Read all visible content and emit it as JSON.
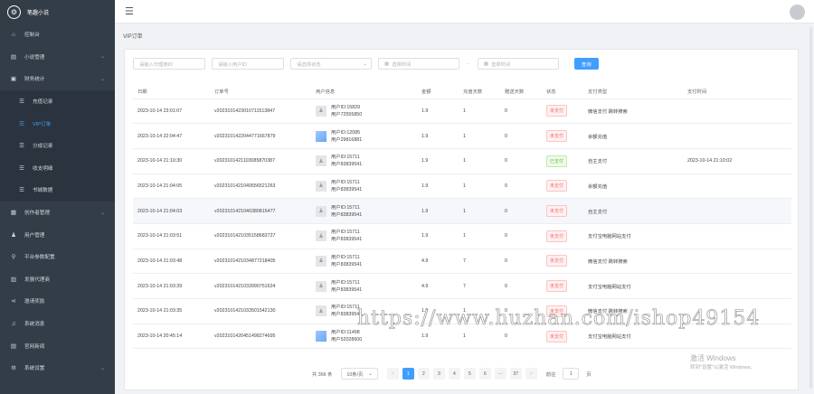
{
  "app": {
    "brand": "笔趣小说",
    "logo_icon": "settings-logo-icon"
  },
  "sidebar": {
    "items": [
      {
        "label": "控制台",
        "icon": "home-icon",
        "glyph": "⌂",
        "caret": false
      },
      {
        "label": "小说管理",
        "icon": "book-icon",
        "glyph": "▤",
        "caret": true
      },
      {
        "label": "财务统计",
        "icon": "money-icon",
        "glyph": "▣",
        "caret": true
      }
    ],
    "sub_items": [
      {
        "label": "充值记录",
        "glyph": "☰",
        "active": false
      },
      {
        "label": "VIP订单",
        "glyph": "☰",
        "active": true
      },
      {
        "label": "分成记录",
        "glyph": "☰",
        "active": false
      },
      {
        "label": "收支明细",
        "glyph": "☰",
        "active": false
      },
      {
        "label": "书城数据",
        "glyph": "☰",
        "active": false
      }
    ],
    "items_after": [
      {
        "label": "创作者管理",
        "icon": "users-icon",
        "glyph": "▦",
        "caret": true
      },
      {
        "label": "用户管理",
        "icon": "user-icon",
        "glyph": "♟",
        "caret": false
      },
      {
        "label": "平台参数配置",
        "icon": "pin-icon",
        "glyph": "⚲",
        "caret": false
      },
      {
        "label": "发展代理商",
        "icon": "grid-icon",
        "glyph": "▥",
        "caret": false
      },
      {
        "label": "邀请奖励",
        "icon": "share-icon",
        "glyph": "⋖",
        "caret": false
      },
      {
        "label": "系统消息",
        "icon": "bell-icon",
        "glyph": "♫",
        "caret": false
      },
      {
        "label": "官网新闻",
        "icon": "news-icon",
        "glyph": "▤",
        "caret": false
      },
      {
        "label": "系统设置",
        "icon": "gear-icon",
        "glyph": "⚙",
        "caret": true
      }
    ]
  },
  "topbar": {
    "menu_glyph": "☰"
  },
  "breadcrumb": "VIP订单",
  "filters": {
    "agent_placeholder": "请输入代理商ID",
    "user_placeholder": "请输入用户ID",
    "status_placeholder": "请选择状态",
    "start_placeholder": "选择时间",
    "dash": "-",
    "end_placeholder": "选择时间",
    "query_label": "查询"
  },
  "table": {
    "headers": [
      "日期",
      "订单号",
      "用户信息",
      "金额",
      "充值天数",
      "赠送天数",
      "状态",
      "支付类型",
      "支付时间"
    ],
    "rows": [
      {
        "date": "2023-10-14 23:01:07",
        "order": "v2023101423010711513847",
        "uid": "用户ID:15829",
        "uname": "用户72555850",
        "photo": false,
        "amount": "1.9",
        "days": "1",
        "gift": "0",
        "status": "未支付",
        "paid": false,
        "pay_type": "微信支付 跳转搜索",
        "pay_time": "",
        "hl": false
      },
      {
        "date": "2023-10-14 22:04:47",
        "order": "v2023101422044771667879",
        "uid": "用户ID:12085",
        "uname": "用户29816881",
        "photo": true,
        "amount": "1.9",
        "days": "1",
        "gift": "0",
        "status": "未支付",
        "paid": false,
        "pay_type": "余额充值",
        "pay_time": "",
        "hl": false
      },
      {
        "date": "2023-10-14 21:10:30",
        "order": "v2023101421103085870387",
        "uid": "用户ID:15711",
        "uname": "用户83839541",
        "photo": false,
        "amount": "1.9",
        "days": "1",
        "gift": "0",
        "status": "已支付",
        "paid": true,
        "pay_type": "自主支付",
        "pay_time": "2023-10-14 21:10:02",
        "hl": false
      },
      {
        "date": "2023-10-14 21:04:05",
        "order": "v2023101421040556521263",
        "uid": "用户ID:15711",
        "uname": "用户83839541",
        "photo": false,
        "amount": "1.9",
        "days": "1",
        "gift": "0",
        "status": "未支付",
        "paid": false,
        "pay_type": "余额充值",
        "pay_time": "",
        "hl": false
      },
      {
        "date": "2023-10-14 21:04:03",
        "order": "v2023101421040380815477",
        "uid": "用户ID:15711",
        "uname": "用户83839541",
        "photo": false,
        "amount": "1.9",
        "days": "1",
        "gift": "0",
        "status": "未支付",
        "paid": false,
        "pay_type": "自主支付",
        "pay_time": "",
        "hl": true
      },
      {
        "date": "2023-10-14 21:03:51",
        "order": "v2023101421035158683727",
        "uid": "用户ID:15711",
        "uname": "用户83839541",
        "photo": false,
        "amount": "1.9",
        "days": "1",
        "gift": "0",
        "status": "未支付",
        "paid": false,
        "pay_type": "支付宝电脑网站支付",
        "pay_time": "",
        "hl": false
      },
      {
        "date": "2023-10-14 21:03:48",
        "order": "v2023101421034877218405",
        "uid": "用户ID:15711",
        "uname": "用户83839541",
        "photo": false,
        "amount": "4.9",
        "days": "7",
        "gift": "0",
        "status": "未支付",
        "paid": false,
        "pay_type": "微信支付 跳转搜索",
        "pay_time": "",
        "hl": false
      },
      {
        "date": "2023-10-14 21:03:39",
        "order": "v2023101421033990751624",
        "uid": "用户ID:15711",
        "uname": "用户83839541",
        "photo": false,
        "amount": "4.9",
        "days": "7",
        "gift": "0",
        "status": "未支付",
        "paid": false,
        "pay_type": "支付宝电脑网站支付",
        "pay_time": "",
        "hl": false
      },
      {
        "date": "2023-10-14 21:03:35",
        "order": "v2023101421033501542130",
        "uid": "用户ID:15711",
        "uname": "用户83839541",
        "photo": false,
        "amount": "1.9",
        "days": "1",
        "gift": "0",
        "status": "未支付",
        "paid": false,
        "pay_type": "微信支付 跳转搜索",
        "pay_time": "",
        "hl": false
      },
      {
        "date": "2023-10-14 20:45:14",
        "order": "v2023101420451498274695",
        "uid": "用户ID:11498",
        "uname": "用户52028600",
        "photo": true,
        "amount": "1.9",
        "days": "1",
        "gift": "0",
        "status": "未支付",
        "paid": false,
        "pay_type": "支付宝电脑网站支付",
        "pay_time": "",
        "hl": false
      }
    ]
  },
  "pagination": {
    "total": "共 366 条",
    "page_size": "10条/页",
    "prev": "<",
    "pages": [
      "1",
      "2",
      "3",
      "4",
      "5",
      "6",
      "···",
      "37"
    ],
    "next": ">",
    "goto_label": "前往",
    "goto_value": "1",
    "page_suffix": "页"
  },
  "watermark": "https://www.huzhan.com/ishop49154",
  "activation": {
    "line1": "激活 Windows",
    "line2": "转到\"设置\"以激活 Windows。"
  }
}
